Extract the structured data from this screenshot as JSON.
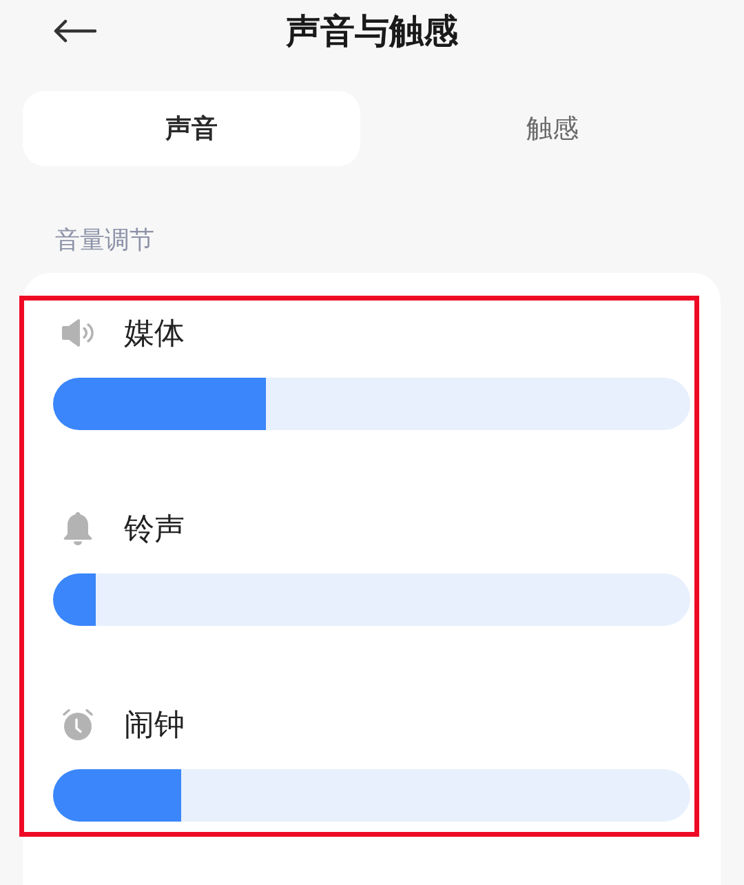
{
  "header": {
    "title": "声音与触感"
  },
  "tabs": [
    {
      "label": "声音",
      "selected": true
    },
    {
      "label": "触感",
      "selected": false
    }
  ],
  "section": {
    "title": "音量调节"
  },
  "volume_sliders": [
    {
      "kind": "media",
      "label": "媒体",
      "level": 0.334
    },
    {
      "kind": "ringtone",
      "label": "铃声",
      "level": 0.067
    },
    {
      "kind": "alarm",
      "label": "闹钟",
      "level": 0.201
    }
  ]
}
